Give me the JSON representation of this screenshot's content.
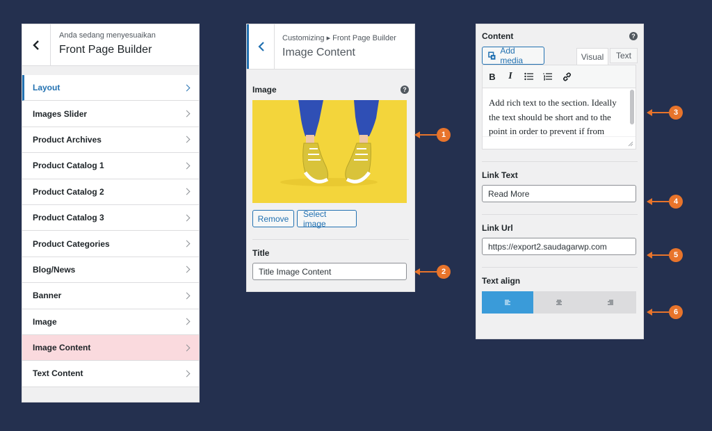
{
  "panel1": {
    "preheader": "Anda sedang menyesuaikan",
    "title": "Front Page Builder",
    "items": [
      {
        "label": "Layout"
      },
      {
        "label": "Images Slider"
      },
      {
        "label": "Product Archives"
      },
      {
        "label": "Product Catalog 1"
      },
      {
        "label": "Product Catalog 2"
      },
      {
        "label": "Product Catalog 3"
      },
      {
        "label": "Product Categories"
      },
      {
        "label": "Blog/News"
      },
      {
        "label": "Banner"
      },
      {
        "label": "Image"
      },
      {
        "label": "Image Content"
      },
      {
        "label": "Text Content"
      }
    ]
  },
  "panel2": {
    "breadcrumb": "Customizing ▸ Front Page Builder",
    "title": "Image Content",
    "image_label": "Image",
    "help": "?",
    "remove_label": "Remove",
    "select_label": "Select image",
    "title_label": "Title",
    "title_value": "Title Image Content"
  },
  "panel3": {
    "content_label": "Content",
    "help": "?",
    "add_media_label": "Add media",
    "tab_visual": "Visual",
    "tab_text": "Text",
    "toolbar": {
      "bold": "B",
      "italic": "I"
    },
    "editor_text": "Add rich text to the section. Ideally the text should be short and to the point in order to prevent if from being taller",
    "link_text_label": "Link Text",
    "link_text_value": "Read More",
    "link_url_label": "Link Url",
    "link_url_value": "https://export2.saudagarwp.com",
    "text_align_label": "Text align"
  },
  "callouts": [
    "1",
    "2",
    "3",
    "4",
    "5",
    "6"
  ],
  "colors": {
    "background": "#24304f",
    "accent": "#2271b1",
    "callout": "#e8742b",
    "highlight": "#fadade",
    "align_active": "#3a9bd9"
  }
}
